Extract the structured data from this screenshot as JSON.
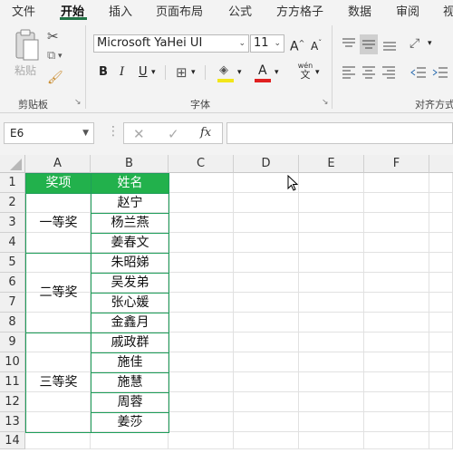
{
  "menu_tabs": [
    "文件",
    "开始",
    "插入",
    "页面布局",
    "公式",
    "方方格子",
    "数据",
    "审阅",
    "视"
  ],
  "active_tab": "开始",
  "accent_color": "#217346",
  "ribbon": {
    "paste_label": "粘贴",
    "clipboard_group": "剪贴板",
    "font_group": "字体",
    "align_group": "对齐方式",
    "font_name": "Microsoft YaHei UI",
    "font_size": "11",
    "grow_font": "A",
    "shrink_font": "A",
    "bold": "B",
    "italic": "I",
    "underline": "U",
    "font_color_glyph": "A",
    "wen_top": "wén",
    "wen_bottom": "文",
    "highlight_color": "#f2e61a",
    "font_color": "#e02020"
  },
  "formula_bar": {
    "name_box": "E6",
    "fx": "fx",
    "cancel": "✕",
    "enter": "✓",
    "formula": ""
  },
  "columns": [
    "A",
    "B",
    "C",
    "D",
    "E",
    "F"
  ],
  "rows": [
    "1",
    "2",
    "3",
    "4",
    "5",
    "6",
    "7",
    "8",
    "9",
    "10",
    "11",
    "12",
    "13",
    "14"
  ],
  "table": {
    "headers": [
      "奖项",
      "姓名"
    ],
    "header_color": "#22b14c",
    "groups": [
      {
        "award": "一等奖",
        "names": [
          "赵宁",
          "杨兰燕",
          "姜春文"
        ]
      },
      {
        "award": "二等奖",
        "names": [
          "朱昭娣",
          "吴发弟",
          "张心媛",
          "金鑫月"
        ]
      },
      {
        "award": "三等奖",
        "names": [
          "戚政群",
          "施佳",
          "施慧",
          "周蓉",
          "姜莎"
        ]
      }
    ]
  }
}
